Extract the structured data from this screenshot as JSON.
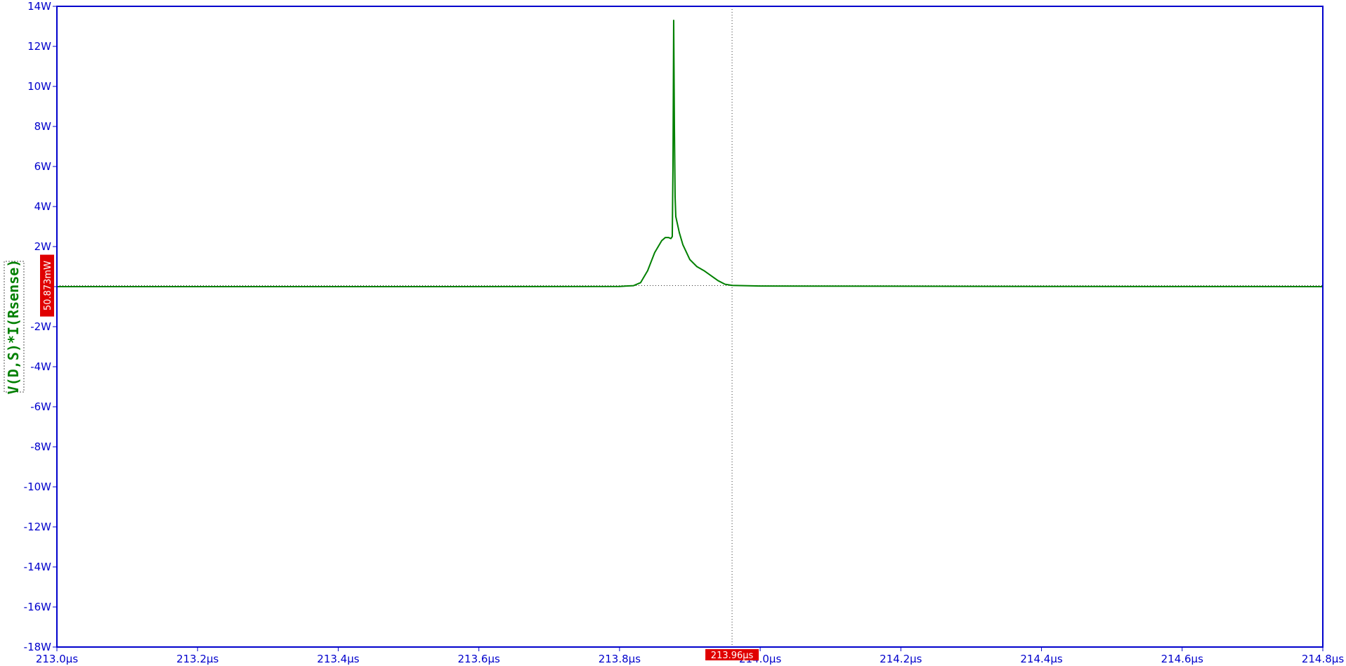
{
  "chart_data": {
    "type": "line",
    "title": "",
    "xlabel": "",
    "ylabel": "V(D,S)*I(Rsense)",
    "xlim": [
      213.0,
      214.8
    ],
    "ylim": [
      -18,
      14
    ],
    "x_unit": "µs",
    "y_unit": "W",
    "grid": false,
    "x_ticks": [
      213.0,
      213.2,
      213.4,
      213.6,
      213.8,
      214.0,
      214.2,
      214.4,
      214.6,
      214.8
    ],
    "x_tick_labels": [
      "213.0µs",
      "213.2µs",
      "213.4µs",
      "213.6µs",
      "213.8µs",
      "214.0µs",
      "214.2µs",
      "214.4µs",
      "214.6µs",
      "214.8µs"
    ],
    "y_ticks": [
      14,
      12,
      10,
      8,
      6,
      4,
      2,
      0,
      -2,
      -4,
      -6,
      -8,
      -10,
      -12,
      -14,
      -16,
      -18
    ],
    "y_tick_labels": [
      "14W",
      "12W",
      "10W",
      "8W",
      "6W",
      "4W",
      "2W",
      "0",
      "-2W",
      "-4W",
      "-6W",
      "-8W",
      "-10W",
      "-12W",
      "-14W",
      "-16W",
      "-18W"
    ],
    "series": [
      {
        "name": "V(D,S)*I(Rsense)",
        "color": "#008000",
        "x": [
          213.0,
          213.5,
          213.8,
          213.82,
          213.83,
          213.84,
          213.85,
          213.86,
          213.865,
          213.87,
          213.873,
          213.875,
          213.876,
          213.877,
          213.878,
          213.879,
          213.88,
          213.885,
          213.89,
          213.9,
          213.91,
          213.92,
          213.93,
          213.94,
          213.95,
          213.96,
          214.0,
          214.4,
          214.8
        ],
        "y": [
          0.0,
          0.0,
          0.01,
          0.05,
          0.2,
          0.8,
          1.7,
          2.3,
          2.45,
          2.45,
          2.4,
          2.5,
          6.0,
          13.3,
          8.0,
          4.5,
          3.5,
          2.7,
          2.1,
          1.35,
          1.0,
          0.8,
          0.55,
          0.3,
          0.12,
          0.06,
          0.03,
          0.01,
          0.0
        ]
      }
    ],
    "cursor": {
      "x": 213.96,
      "y": 0.050873,
      "x_label": "213.96µs",
      "y_label": "50.873mW"
    }
  }
}
